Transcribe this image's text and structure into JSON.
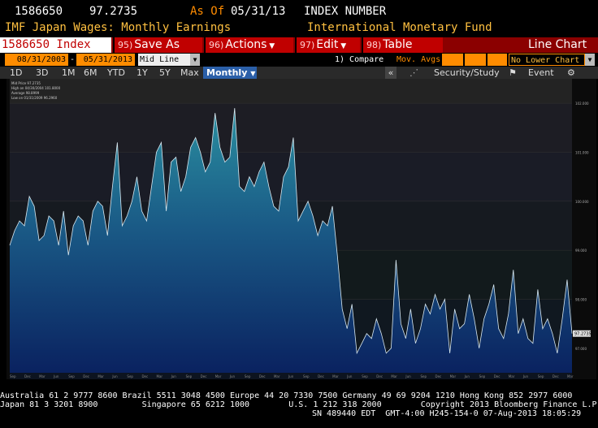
{
  "header": {
    "ticker": "1586650",
    "price": "97.2735",
    "as_of_label": "As Of",
    "as_of_date": "05/31/13",
    "unit": "INDEX NUMBER",
    "title": "IMF Japan Wages: Monthly Earnings",
    "source": "International Monetary Fund"
  },
  "toolbar": {
    "index": "1586650 Index",
    "save_num": "95)",
    "save": "Save As",
    "actions_num": "96)",
    "actions": "Actions",
    "edit_num": "97)",
    "edit": "Edit",
    "table_num": "98)",
    "table": "Table",
    "chart_type": "Line Chart"
  },
  "range": {
    "start": "08/31/2003",
    "sep": "-",
    "end": "05/31/2013",
    "mid": "Mid Line",
    "compare": "1) Compare",
    "mov": "Mov. Avgs",
    "lower": "No Lower Chart"
  },
  "periods": {
    "items": [
      "1D",
      "3D",
      "1M",
      "6M",
      "YTD",
      "1Y",
      "5Y",
      "Max"
    ],
    "selected": "Monthly",
    "security": "Security/Study",
    "event": "Event"
  },
  "legend": [
    "Mid Price  97.2735",
    "High on 04/30/2004  101.8000",
    "Average  98.8999",
    "Low on 01/31/2009  96.2960"
  ],
  "footer": {
    "line1": "Australia 61 2 9777 8600 Brazil 5511 3048 4500 Europe 44 20 7330 7500 Germany 49 69 9204 1210 Hong Kong 852 2977 6000",
    "line2": "Japan 81 3 3201 8900         Singapore 65 6212 1000        U.S. 1 212 318 2000        Copyright 2013 Bloomberg Finance L.P.",
    "line3": "SN 489440 EDT  GMT-4:00 H245-154-0 07-Aug-2013 18:05:29"
  },
  "colors": {
    "accent": "#c00000",
    "orange": "#ff8c00",
    "amber": "#ffc040"
  },
  "chart_data": {
    "type": "area",
    "x_start": "2003-09",
    "ylim": [
      96.5,
      102.5
    ],
    "yticks": [
      "102.000",
      "101.000",
      "100.000",
      "99.000",
      "98.000",
      "97.000",
      "96.000"
    ],
    "last_value_label": "97.2735",
    "values": [
      99.1,
      99.4,
      99.6,
      99.5,
      100.1,
      99.9,
      99.2,
      99.3,
      99.7,
      99.6,
      99.1,
      99.8,
      98.9,
      99.5,
      99.7,
      99.6,
      99.1,
      99.8,
      100.0,
      99.9,
      99.3,
      100.3,
      101.2,
      99.5,
      99.7,
      100.0,
      100.5,
      99.8,
      99.6,
      100.3,
      101.0,
      101.2,
      99.8,
      100.8,
      100.9,
      100.2,
      100.5,
      101.1,
      101.3,
      101.0,
      100.6,
      100.8,
      101.8,
      101.1,
      100.8,
      100.9,
      101.9,
      100.3,
      100.2,
      100.5,
      100.3,
      100.6,
      100.8,
      100.3,
      99.9,
      99.8,
      100.5,
      100.7,
      101.3,
      99.6,
      99.8,
      100.0,
      99.7,
      99.3,
      99.6,
      99.5,
      99.9,
      98.9,
      97.8,
      97.4,
      97.9,
      96.9,
      97.1,
      97.3,
      97.2,
      97.6,
      97.3,
      96.9,
      97.0,
      98.8,
      97.5,
      97.2,
      97.8,
      97.1,
      97.4,
      97.9,
      97.7,
      98.1,
      97.8,
      98.0,
      96.9,
      97.8,
      97.4,
      97.5,
      98.1,
      97.6,
      97.0,
      97.6,
      97.9,
      98.3,
      97.4,
      97.2,
      97.7,
      98.6,
      97.3,
      97.6,
      97.2,
      97.1,
      98.2,
      97.4,
      97.6,
      97.3,
      96.9,
      97.6,
      98.4,
      97.3
    ]
  }
}
